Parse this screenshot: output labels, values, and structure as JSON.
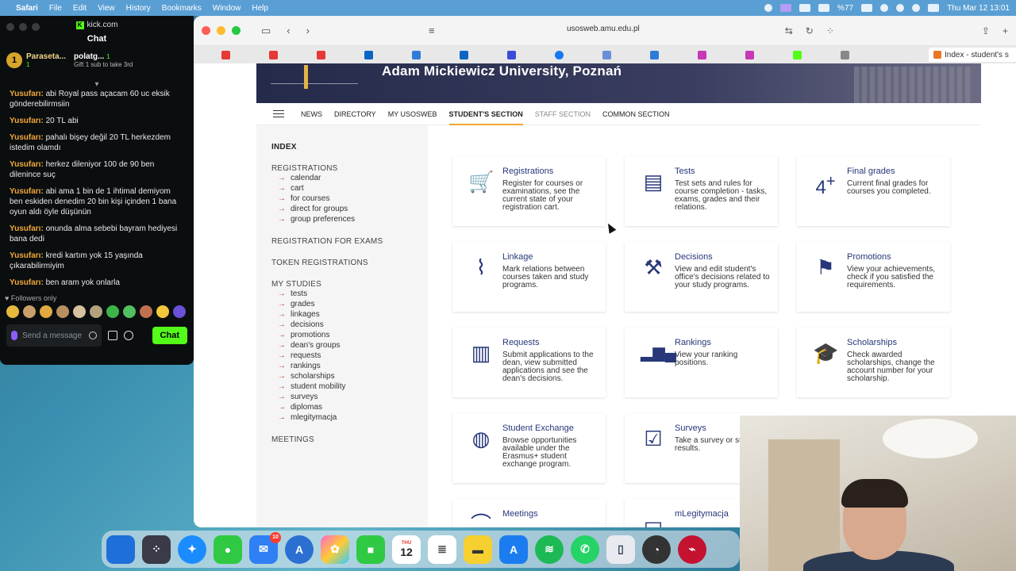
{
  "menubar": {
    "app_name": "Safari",
    "menus": [
      "File",
      "Edit",
      "View",
      "History",
      "Bookmarks",
      "Window",
      "Help"
    ],
    "battery": "%77",
    "clock": "Thu Mar 12  13:01"
  },
  "kick": {
    "url": "kick.com",
    "title": "Chat",
    "gifters": [
      {
        "rank": "1",
        "name": "Paraseta...",
        "count": "1"
      },
      {
        "rank": "",
        "name": "polatg...",
        "count": "1",
        "note": "Gift 1 sub to take 3rd"
      }
    ],
    "messages": [
      {
        "user": "Yusufarı:",
        "text": "abi Royal pass açacam 60 uc eksik gönderebilirmsiin"
      },
      {
        "user": "Yusufarı:",
        "text": "20 TL abi"
      },
      {
        "user": "Yusufarı:",
        "text": "pahalı bişey değil 20 TL herkezdem istedim olamdı"
      },
      {
        "user": "Yusufarı:",
        "text": "herkez dileniyor 100 de 90 ben dilenince suç"
      },
      {
        "user": "Yusufarı:",
        "text": "abi ama 1 bin de 1 ihtimal demiyom ben eskiden denedim 20 bin kişi içinden 1 bana oyun aldı öyle düşünün"
      },
      {
        "user": "Yusufarı:",
        "text": "onunda alma sebebi bayram hediyesi bana dedi"
      },
      {
        "user": "Yusufarı:",
        "text": "kredi kartım yok 15 yaşında çıkarabilirmiyim"
      },
      {
        "user": "Yusufarı:",
        "text": "ben aram yok onlarla"
      }
    ],
    "followers_only": "Followers only",
    "input_placeholder": "Send a message",
    "chat_button": "Chat"
  },
  "safari": {
    "address": "usosweb.amu.edu.pl",
    "active_tab": "Index - student's s"
  },
  "page": {
    "university": "Adam Mickiewicz University, Poznań",
    "nav": [
      "NEWS",
      "DIRECTORY",
      "MY USOSWEB",
      "STUDENT'S SECTION",
      "STAFF SECTION",
      "COMMON SECTION"
    ],
    "sidebar": {
      "index": "INDEX",
      "registrations": "REGISTRATIONS",
      "registrations_items": [
        "calendar",
        "cart",
        "for courses",
        "direct for groups",
        "group preferences"
      ],
      "exams": "REGISTRATION FOR EXAMS",
      "token": "TOKEN REGISTRATIONS",
      "my_studies": "MY STUDIES",
      "my_studies_items": [
        "tests",
        "grades",
        "linkages",
        "decisions",
        "promotions",
        "dean's groups",
        "requests",
        "rankings",
        "scholarships",
        "student mobility",
        "surveys",
        "diplomas",
        "mlegitymacja"
      ],
      "meetings": "MEETINGS"
    },
    "tiles": [
      {
        "title": "Registrations",
        "desc": "Register for courses or examinations, see the current state of your registration cart.",
        "icon": "cart-icon"
      },
      {
        "title": "Tests",
        "desc": "Test sets and rules for course completion - tasks, exams, grades and their relations.",
        "icon": "tests-icon"
      },
      {
        "title": "Final grades",
        "desc": "Current final grades for courses you completed.",
        "icon": "grade-icon"
      },
      {
        "title": "Linkage",
        "desc": "Mark relations between courses taken and study programs.",
        "icon": "paperclip-icon"
      },
      {
        "title": "Decisions",
        "desc": "View and edit student's office's decisions related to your study programs.",
        "icon": "gavel-icon"
      },
      {
        "title": "Promotions",
        "desc": "View your achievements, check if you satisfied the requirements.",
        "icon": "flag-icon"
      },
      {
        "title": "Requests",
        "desc": "Submit applications to the dean, view submitted applications and see the dean's decisions.",
        "icon": "document-icon"
      },
      {
        "title": "Rankings",
        "desc": "View your ranking positions.",
        "icon": "podium-icon"
      },
      {
        "title": "Scholarships",
        "desc": "Check awarded scholarships, change the account number for your scholarship.",
        "icon": "scholarship-icon"
      },
      {
        "title": "Student Exchange",
        "desc": "Browse opportunities available under the Erasmus+ student exchange program.",
        "icon": "graduate-globe-icon"
      },
      {
        "title": "Surveys",
        "desc": "Take a survey or survey results.",
        "icon": "survey-icon"
      },
      {
        "title": "Meetings",
        "desc": "",
        "icon": "meetings-icon"
      },
      {
        "title": "mLegitymacja",
        "desc": "",
        "icon": "id-card-icon"
      }
    ]
  },
  "dock": {
    "mail_badge": "10",
    "calendar_day": "12",
    "calendar_month": "THU"
  }
}
